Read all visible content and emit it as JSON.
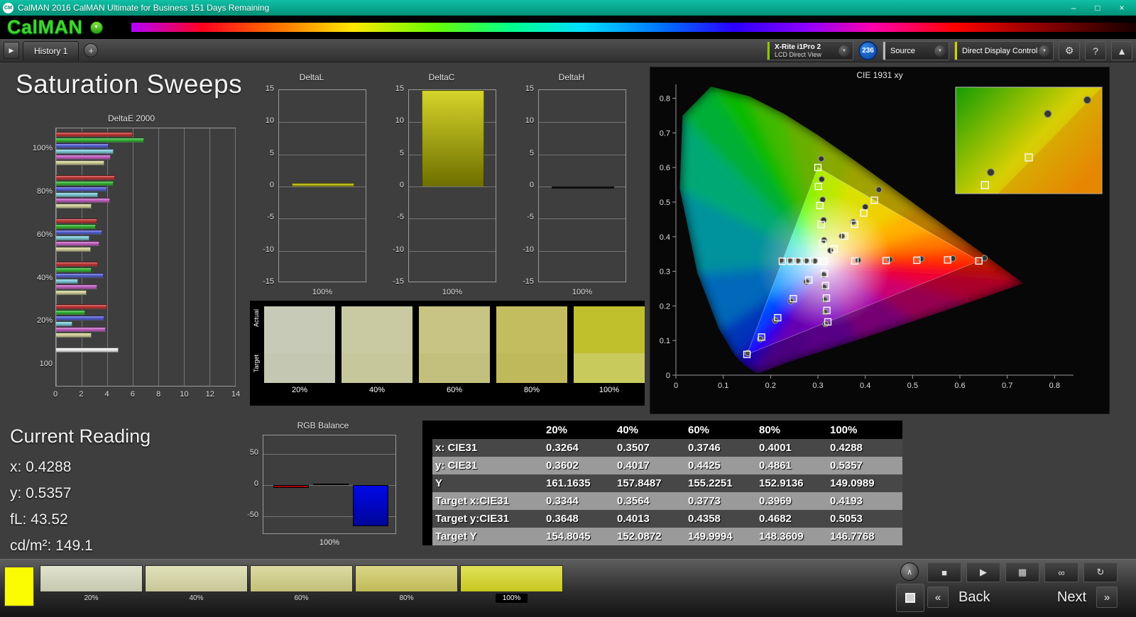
{
  "window": {
    "title": "CalMAN 2016 CalMAN Ultimate for Business 151 Days Remaining",
    "logo_badge": "CM",
    "controls": {
      "minimize": "–",
      "maximize": "□",
      "close": "×"
    }
  },
  "brand": {
    "name": "CalMAN",
    "dropdown_icon": "▼"
  },
  "tabbar": {
    "nav_icon": "▶",
    "tab": "History 1",
    "add": "+"
  },
  "toolbar": {
    "meter_line1": "X-Rite i1Pro 2",
    "meter_line2": "LCD Direct View",
    "meter_accent": "#8cc700",
    "badge": "236",
    "source_label": "Source",
    "source_accent": "#b8b8b8",
    "display_label": "Direct Display Control",
    "display_accent": "#ccd400",
    "dropdown_icon": "▼",
    "gear_icon": "⚙",
    "help_icon": "?",
    "collapse_icon": "▲"
  },
  "page_title": "Saturation Sweeps",
  "current_reading": {
    "heading": "Current Reading",
    "lines": [
      "x: 0.4288",
      "y: 0.5357",
      "fL: 43.52",
      "cd/m²: 149.1"
    ]
  },
  "results_table": {
    "headers": [
      "20%",
      "40%",
      "60%",
      "80%",
      "100%"
    ],
    "rows": [
      {
        "label": "x: CIE31",
        "values": [
          "0.3264",
          "0.3507",
          "0.3746",
          "0.4001",
          "0.4288"
        ]
      },
      {
        "label": "y: CIE31",
        "values": [
          "0.3602",
          "0.4017",
          "0.4425",
          "0.4861",
          "0.5357"
        ]
      },
      {
        "label": "Y",
        "values": [
          "161.1635",
          "157.8487",
          "155.2251",
          "152.9136",
          "149.0989"
        ]
      },
      {
        "label": "Target x:CIE31",
        "values": [
          "0.3344",
          "0.3564",
          "0.3773",
          "0.3969",
          "0.4193"
        ]
      },
      {
        "label": "Target y:CIE31",
        "values": [
          "0.3648",
          "0.4013",
          "0.4358",
          "0.4682",
          "0.5053"
        ]
      },
      {
        "label": "Target Y",
        "values": [
          "154.8045",
          "152.0872",
          "149.9994",
          "148.3609",
          "146.7768"
        ]
      }
    ],
    "row_colors": [
      "#474747",
      "#9a9a9a"
    ]
  },
  "swatch_panel": {
    "row_labels": [
      "Actual",
      "Target"
    ],
    "items": [
      {
        "label": "20%",
        "actual": "#c7cab6",
        "target": "#c4c7b1"
      },
      {
        "label": "40%",
        "actual": "#cacaa2",
        "target": "#c7c79c"
      },
      {
        "label": "60%",
        "actual": "#c7c484",
        "target": "#c3c07e"
      },
      {
        "label": "80%",
        "actual": "#c3bd60",
        "target": "#bfb95b"
      },
      {
        "label": "100%",
        "actual": "#bfc02c",
        "target": "#c8ca5b"
      }
    ]
  },
  "bottom_bar": {
    "patch_color": "#fbfb02",
    "swatches": [
      {
        "label": "20%",
        "color": "#d6d9bd",
        "selected": false
      },
      {
        "label": "40%",
        "color": "#d8d8a4",
        "selected": false
      },
      {
        "label": "60%",
        "color": "#d2cf82",
        "selected": false
      },
      {
        "label": "80%",
        "color": "#cfc95e",
        "selected": false
      },
      {
        "label": "100%",
        "color": "#d8d822",
        "selected": true
      }
    ],
    "controls": [
      {
        "name": "stop",
        "icon": "■"
      },
      {
        "name": "play",
        "icon": "▶"
      },
      {
        "name": "save",
        "icon": "▦"
      },
      {
        "name": "loop",
        "icon": "∞"
      },
      {
        "name": "refresh",
        "icon": "↻"
      }
    ],
    "icons": {
      "up": "∧",
      "back_chev": "«",
      "next_chev": "»"
    },
    "back": "Back",
    "next": "Next"
  },
  "chart_data": [
    {
      "id": "deltae2000",
      "type": "bar",
      "orientation": "horizontal",
      "title": "DeltaE 2000",
      "xlim": [
        0,
        14
      ],
      "xticks": [
        0,
        2,
        4,
        6,
        8,
        10,
        12,
        14
      ],
      "categories": [
        "100%",
        "80%",
        "60%",
        "40%",
        "20%",
        "100"
      ],
      "series": [
        {
          "name": "red",
          "color": "#c03636",
          "values": [
            6.0,
            4.6,
            3.2,
            3.3,
            4.0,
            0
          ]
        },
        {
          "name": "green",
          "color": "#35b335",
          "values": [
            6.9,
            4.5,
            3.1,
            2.8,
            2.3,
            0
          ]
        },
        {
          "name": "blue",
          "color": "#5560d0",
          "values": [
            4.1,
            4.0,
            3.6,
            3.7,
            3.8,
            0
          ]
        },
        {
          "name": "cyan",
          "color": "#7ec8d8",
          "values": [
            4.5,
            3.3,
            2.6,
            1.7,
            1.3,
            0
          ]
        },
        {
          "name": "magenta",
          "color": "#c060c0",
          "values": [
            4.3,
            4.2,
            3.4,
            3.2,
            3.9,
            0
          ]
        },
        {
          "name": "yellow",
          "color": "#cfcf9a",
          "values": [
            3.8,
            2.8,
            2.7,
            2.4,
            2.8,
            0
          ]
        },
        {
          "name": "white",
          "color": "#ececec",
          "values": [
            0,
            0,
            0,
            0,
            0,
            4.9
          ]
        }
      ]
    },
    {
      "id": "deltal",
      "type": "bar",
      "title": "DeltaL",
      "categories": [
        "100%"
      ],
      "values": [
        0.5
      ],
      "ylim": [
        -15,
        15
      ],
      "yticks": [
        15,
        10,
        5,
        0,
        -5,
        -10,
        -15
      ],
      "gradient": [
        "#d9d931",
        "#8a8a08"
      ]
    },
    {
      "id": "deltac",
      "type": "bar",
      "title": "DeltaC",
      "categories": [
        "100%"
      ],
      "values": [
        15
      ],
      "ylim": [
        -15,
        15
      ],
      "yticks": [
        15,
        10,
        5,
        0,
        -5,
        -10,
        -15
      ],
      "gradient": [
        "#d4d42a",
        "#6f6f00"
      ]
    },
    {
      "id": "deltah",
      "type": "bar",
      "title": "DeltaH",
      "categories": [
        "100%"
      ],
      "values": [
        -0.3
      ],
      "ylim": [
        -15,
        15
      ],
      "yticks": [
        15,
        10,
        5,
        0,
        -5,
        -10,
        -15
      ],
      "gradient": [
        "#202020",
        "#0a0a0a"
      ]
    },
    {
      "id": "cie",
      "type": "scatter",
      "title": "CIE 1931 xy",
      "xlim": [
        0,
        0.8
      ],
      "ylim": [
        0,
        0.8
      ],
      "xticks": [
        "0",
        "0.1",
        "0.2",
        "0.3",
        "0.4",
        "0.5",
        "0.6",
        "0.7",
        "0.8"
      ],
      "yticks": [
        "0",
        "0.1",
        "0.2",
        "0.3",
        "0.4",
        "0.5",
        "0.6",
        "0.7",
        "0.8"
      ],
      "targets": [
        [
          0.378,
          0.33
        ],
        [
          0.444,
          0.331
        ],
        [
          0.509,
          0.332
        ],
        [
          0.574,
          0.333
        ],
        [
          0.64,
          0.33
        ],
        [
          0.31,
          0.381
        ],
        [
          0.307,
          0.435
        ],
        [
          0.304,
          0.49
        ],
        [
          0.301,
          0.545
        ],
        [
          0.3,
          0.6
        ],
        [
          0.281,
          0.275
        ],
        [
          0.248,
          0.221
        ],
        [
          0.215,
          0.166
        ],
        [
          0.181,
          0.11
        ],
        [
          0.15,
          0.06
        ],
        [
          0.296,
          0.329
        ],
        [
          0.278,
          0.329
        ],
        [
          0.26,
          0.329
        ],
        [
          0.243,
          0.329
        ],
        [
          0.225,
          0.329
        ],
        [
          0.314,
          0.294
        ],
        [
          0.316,
          0.259
        ],
        [
          0.318,
          0.223
        ],
        [
          0.319,
          0.187
        ],
        [
          0.321,
          0.154
        ],
        [
          0.3344,
          0.3648
        ],
        [
          0.3564,
          0.4013
        ],
        [
          0.3773,
          0.4358
        ],
        [
          0.3969,
          0.4682
        ],
        [
          0.4193,
          0.5053
        ],
        [
          0.3127,
          0.329
        ]
      ],
      "measurements": [
        [
          0.385,
          0.332
        ],
        [
          0.452,
          0.334
        ],
        [
          0.518,
          0.336
        ],
        [
          0.585,
          0.337
        ],
        [
          0.652,
          0.338
        ],
        [
          0.313,
          0.39
        ],
        [
          0.312,
          0.448
        ],
        [
          0.31,
          0.507
        ],
        [
          0.308,
          0.566
        ],
        [
          0.307,
          0.625
        ],
        [
          0.276,
          0.27
        ],
        [
          0.243,
          0.214
        ],
        [
          0.21,
          0.158
        ],
        [
          0.178,
          0.104
        ],
        [
          0.152,
          0.064
        ],
        [
          0.293,
          0.33
        ],
        [
          0.275,
          0.331
        ],
        [
          0.257,
          0.331
        ],
        [
          0.24,
          0.332
        ],
        [
          0.222,
          0.332
        ],
        [
          0.312,
          0.29
        ],
        [
          0.313,
          0.254
        ],
        [
          0.314,
          0.218
        ],
        [
          0.315,
          0.182
        ],
        [
          0.316,
          0.148
        ],
        [
          0.3264,
          0.3602
        ],
        [
          0.3507,
          0.4017
        ],
        [
          0.3746,
          0.4425
        ],
        [
          0.4001,
          0.4861
        ],
        [
          0.4288,
          0.5357
        ]
      ],
      "inset": {
        "squares": [
          [
            0.5,
            0.66
          ],
          [
            0.2,
            0.92
          ]
        ],
        "circles": [
          [
            0.63,
            0.25
          ],
          [
            0.24,
            0.8
          ],
          [
            0.9,
            0.12
          ]
        ]
      }
    },
    {
      "id": "rgbbalance",
      "type": "bar",
      "title": "RGB Balance",
      "categories": [
        "red",
        "green",
        "blue"
      ],
      "values": [
        -4,
        2,
        -66
      ],
      "colors": [
        "#c00000",
        "#00a500",
        "#0008e8"
      ],
      "ylim": [
        -80,
        80
      ],
      "yticks": [
        50,
        0,
        -50
      ],
      "xlabel": "100%"
    }
  ]
}
